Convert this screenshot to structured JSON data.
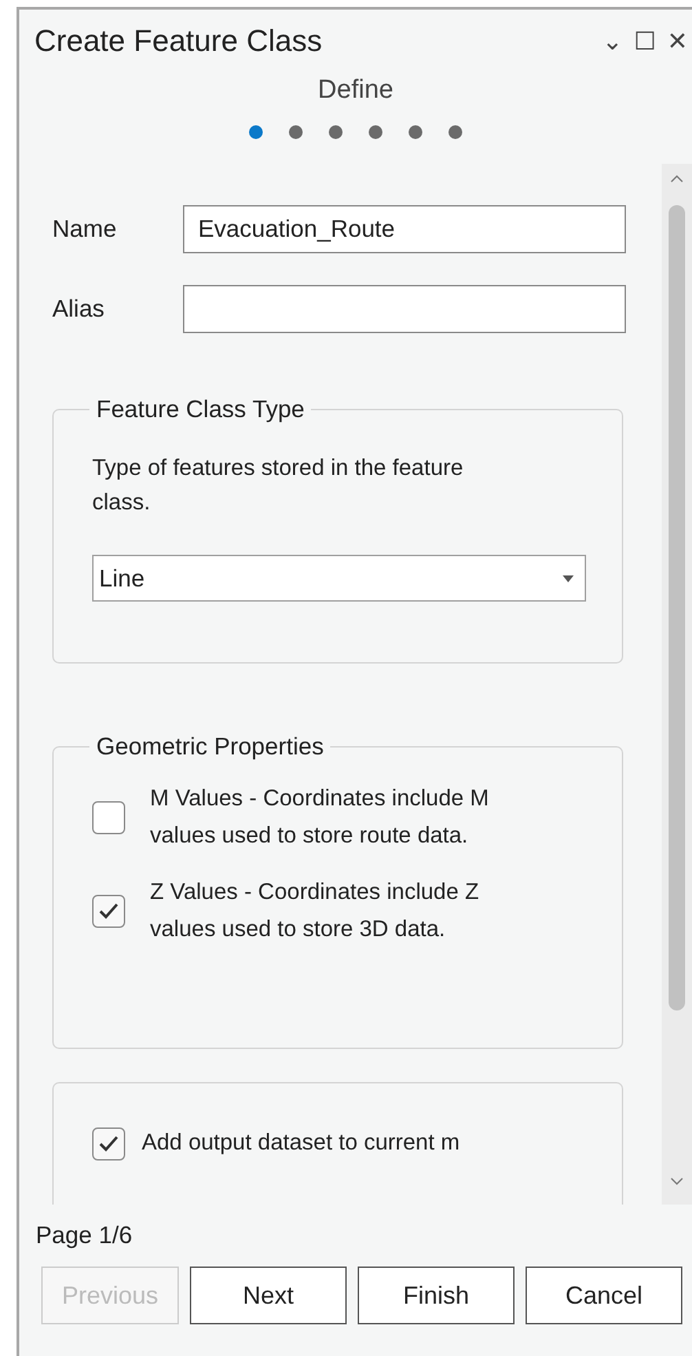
{
  "window": {
    "title": "Create Feature Class",
    "controls": [
      "⌄",
      "☐",
      "✕"
    ]
  },
  "page_title": "Define",
  "steps": [
    {
      "selected": true
    },
    {
      "selected": false
    },
    {
      "selected": false
    },
    {
      "selected": false
    },
    {
      "selected": false
    },
    {
      "selected": false
    }
  ],
  "fields": [
    {
      "label": "Name",
      "value": "Evacuation_Route"
    },
    {
      "label": "Alias"
    }
  ],
  "feature_class_type": {
    "legend": "Feature Class Type",
    "description": "Type of features stored in the feature class.",
    "dropdown": "Line"
  },
  "geometric_properties": {
    "legend": "Geometric Properties",
    "options": [
      {
        "label": "M Values - Coordinates include M values used to store route data.",
        "checked": false
      },
      {
        "label": "Z Values - Coordinates include Z values used to store 3D data.",
        "checked": true
      }
    ]
  },
  "output": {
    "label": "Add output dataset to current m",
    "checked": true
  },
  "page_indicator": "Page 1/6",
  "buttons": [
    {
      "label": "Previous",
      "disabled": true
    },
    {
      "label": "Next",
      "disabled": false
    },
    {
      "label": "Finish",
      "disabled": false
    },
    {
      "label": "Cancel",
      "disabled": false
    }
  ]
}
